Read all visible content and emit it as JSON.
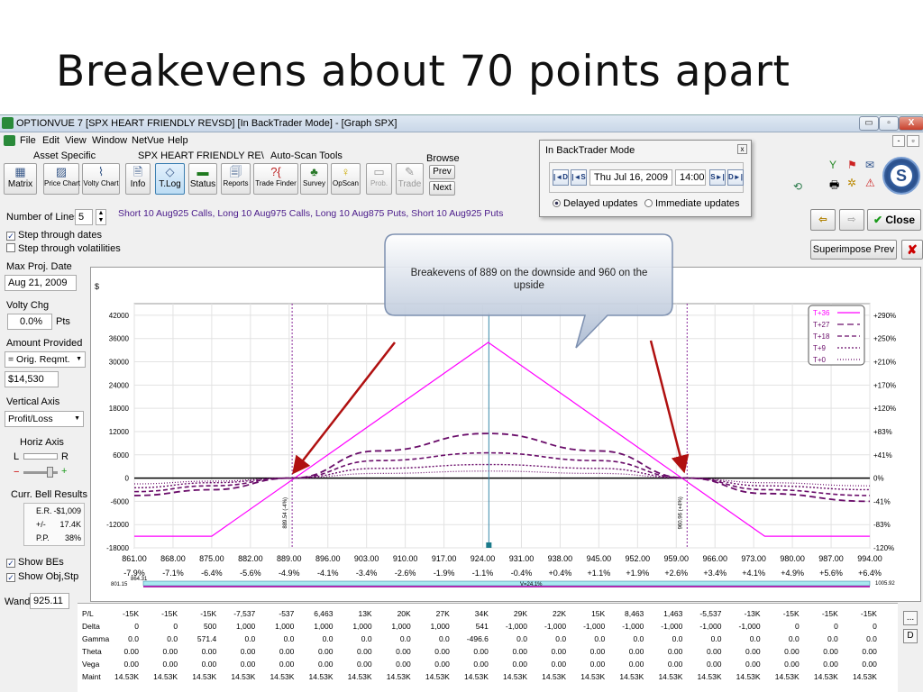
{
  "slide_title": "Breakevens about 70 points apart",
  "window": {
    "title": "OPTIONVUE 7  [SPX HEART FRIENDLY REVSD]  [In BackTrader Mode] - [Graph SPX]",
    "min_label": "▭",
    "max_label": "▫",
    "close_label": "X"
  },
  "menu": [
    "File",
    "Edit",
    "View",
    "Window",
    "NetVue",
    "Help"
  ],
  "mdi_buttons": [
    "-",
    "▫"
  ],
  "toolbar": {
    "asset_label": "Asset Specific",
    "strategy_label": "SPX HEART FRIENDLY RE\\",
    "autoscan_label": "Auto-Scan Tools",
    "browse_label": "Browse",
    "buttons": {
      "matrix": "Matrix",
      "price_chart": "Price Chart",
      "volty_chart": "Volty Chart",
      "info": "Info",
      "tlog": "T.Log",
      "status": "Status",
      "reports": "Reports",
      "trade_finder": "Trade Finder",
      "survey": "Survey",
      "opscan": "OpScan",
      "prob": "Prob.",
      "trade": "Trade"
    },
    "prev": "Prev",
    "next": "Next"
  },
  "backtrader": {
    "title": "In BackTrader Mode",
    "close": "x",
    "date": "Thu Jul 16, 2009",
    "time": "14:00",
    "nav": [
      "|◄D",
      "|◄S",
      "S►|",
      "D►|"
    ],
    "delayed": "Delayed updates",
    "immediate": "Immediate updates"
  },
  "strategy_text": "Short 10 Aug925 Calls, Long 10 Aug975 Calls, Long 10 Aug875 Puts, Short 10 Aug925 Puts",
  "actions": {
    "close": "Close",
    "superimpose": "Superimpose Prev",
    "cancel": "✘"
  },
  "left_panel": {
    "num_lines_label": "Number of Lines",
    "num_lines": "5",
    "step_dates": "Step through dates",
    "step_vols": "Step through volatilities",
    "max_proj_label": "Max Proj. Date",
    "max_proj": "Aug 21, 2009",
    "volty_label": "Volty Chg",
    "volty": "0.0%",
    "volty_unit": "Pts",
    "amount_label": "Amount Provided",
    "amount_select": "= Orig. Reqmt.",
    "amount_value": "$14,530",
    "vaxis_label": "Vertical Axis",
    "vaxis_select": "Profit/Loss",
    "haxis_label": "Horiz Axis",
    "haxis_l": "L",
    "haxis_r": "R",
    "minus": "−",
    "plus": "+",
    "bell_label": "Curr. Bell Results",
    "bell": [
      {
        "k": "E.R.",
        "v": "-$1,009"
      },
      {
        "k": "+/-",
        "v": "17.4K"
      },
      {
        "k": "P.P.",
        "v": "38%"
      }
    ],
    "show_bes": "Show BEs",
    "show_obj": "Show Obj,Stp",
    "wand_label": "Wand",
    "wand": "925.11"
  },
  "callout": {
    "text": "Breakevens of 889 on the downside and 960 on the upside"
  },
  "colors": {
    "expiry_line": "#ff00ff",
    "dashed_line": "#6a0d6a",
    "arrow": "#b01010"
  },
  "chart_data": {
    "type": "line",
    "currency_label": "$",
    "x_ticks": [
      "861.00",
      "868.00",
      "875.00",
      "882.00",
      "889.00",
      "896.00",
      "903.00",
      "910.00",
      "917.00",
      "924.00",
      "931.00",
      "938.00",
      "945.00",
      "952.00",
      "959.00",
      "966.00",
      "973.00",
      "980.00",
      "987.00",
      "994.00"
    ],
    "x_pct": [
      "-7.9%",
      "-7.1%",
      "-6.4%",
      "-5.6%",
      "-4.9%",
      "-4.1%",
      "-3.4%",
      "-2.6%",
      "-1.9%",
      "-1.1%",
      "-0.4%",
      "+0.4%",
      "+1.1%",
      "+1.9%",
      "+2.6%",
      "+3.4%",
      "+4.1%",
      "+4.9%",
      "+5.6%",
      "+6.4%"
    ],
    "xlim": [
      861,
      994
    ],
    "y_ticks": [
      "42000",
      "36000",
      "30000",
      "24000",
      "18000",
      "12000",
      "6000",
      "0",
      "-6000",
      "-12000",
      "-18000"
    ],
    "ylim": [
      -18000,
      45000
    ],
    "y_pct": [
      "+290%",
      "+250%",
      "+210%",
      "+170%",
      "+120%",
      "+83%",
      "+41%",
      "0%",
      "-41%",
      "-83%",
      "-120%"
    ],
    "breakevens": [
      {
        "x": 889.54,
        "label": "889.54 (-4%)"
      },
      {
        "x": 960.96,
        "label": "960.96 (+4%)"
      }
    ],
    "current_price": 925.11,
    "legend": [
      {
        "name": "T+36"
      },
      {
        "name": "T+27"
      },
      {
        "name": "T+18"
      },
      {
        "name": "T+9"
      },
      {
        "name": "T+0"
      }
    ],
    "series": [
      {
        "name": "T+36",
        "x": [
          861,
          875,
          925,
          975,
          994
        ],
        "values": [
          -15000,
          -15000,
          35000,
          -15000,
          -15000
        ]
      },
      {
        "name": "T+27",
        "x": [
          861,
          875,
          889.5,
          905,
          925,
          945,
          960.96,
          975,
          994
        ],
        "values": [
          -4500,
          -3000,
          0,
          7000,
          11500,
          7000,
          0,
          -4000,
          -6000
        ]
      },
      {
        "name": "T+18",
        "x": [
          861,
          875,
          889.5,
          905,
          925,
          945,
          960.96,
          975,
          994
        ],
        "values": [
          -3500,
          -2000,
          0,
          4500,
          6500,
          4500,
          0,
          -3000,
          -4500
        ]
      },
      {
        "name": "T+9",
        "x": [
          861,
          875,
          889.5,
          905,
          925,
          945,
          960.96,
          975,
          994
        ],
        "values": [
          -2500,
          -1200,
          0,
          2500,
          3500,
          2500,
          0,
          -2000,
          -3000
        ]
      },
      {
        "name": "T+0",
        "x": [
          861,
          875,
          889.5,
          905,
          925,
          945,
          960.96,
          975,
          994
        ],
        "values": [
          -1500,
          -800,
          0,
          1200,
          1800,
          1200,
          0,
          -1200,
          -2000
        ]
      }
    ],
    "bell_left": "801.15",
    "bell_left2": "864.31",
    "bell_center": "V=24.1%",
    "bell_right": "1005.92"
  },
  "greeks": {
    "labels": [
      "P/L",
      "Delta",
      "Gamma",
      "Theta",
      "Vega",
      "Maint"
    ],
    "rows": [
      [
        "-15K",
        "-15K",
        "-15K",
        "-7,537",
        "-537",
        "6,463",
        "13K",
        "20K",
        "27K",
        "34K",
        "29K",
        "22K",
        "15K",
        "8,463",
        "1,463",
        "-5,537",
        "-13K",
        "-15K",
        "-15K",
        "-15K"
      ],
      [
        "0",
        "0",
        "500",
        "1,000",
        "1,000",
        "1,000",
        "1,000",
        "1,000",
        "1,000",
        "541",
        "-1,000",
        "-1,000",
        "-1,000",
        "-1,000",
        "-1,000",
        "-1,000",
        "-1,000",
        "0",
        "0",
        "0"
      ],
      [
        "0.0",
        "0.0",
        "571.4",
        "0.0",
        "0.0",
        "0.0",
        "0.0",
        "0.0",
        "0.0",
        "-496.6",
        "0.0",
        "0.0",
        "0.0",
        "0.0",
        "0.0",
        "0.0",
        "0.0",
        "0.0",
        "0.0",
        "0.0"
      ],
      [
        "0.00",
        "0.00",
        "0.00",
        "0.00",
        "0.00",
        "0.00",
        "0.00",
        "0.00",
        "0.00",
        "0.00",
        "0.00",
        "0.00",
        "0.00",
        "0.00",
        "0.00",
        "0.00",
        "0.00",
        "0.00",
        "0.00",
        "0.00"
      ],
      [
        "0.00",
        "0.00",
        "0.00",
        "0.00",
        "0.00",
        "0.00",
        "0.00",
        "0.00",
        "0.00",
        "0.00",
        "0.00",
        "0.00",
        "0.00",
        "0.00",
        "0.00",
        "0.00",
        "0.00",
        "0.00",
        "0.00",
        "0.00"
      ],
      [
        "14.53K",
        "14.53K",
        "14.53K",
        "14.53K",
        "14.53K",
        "14.53K",
        "14.53K",
        "14.53K",
        "14.53K",
        "14.53K",
        "14.53K",
        "14.53K",
        "14.53K",
        "14.53K",
        "14.53K",
        "14.53K",
        "14.53K",
        "14.53K",
        "14.53K",
        "14.53K"
      ]
    ],
    "side_buttons": [
      "...",
      "D"
    ]
  }
}
